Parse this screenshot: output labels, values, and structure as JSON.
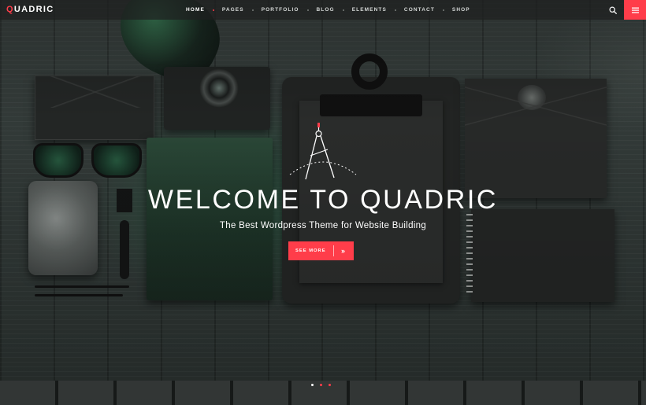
{
  "brand": {
    "first_letter": "Q",
    "rest": "UADRIC",
    "accent": "#ff3d4a"
  },
  "nav": {
    "items": [
      {
        "label": "HOME",
        "active": true
      },
      {
        "label": "PAGES"
      },
      {
        "label": "PORTFOLIO"
      },
      {
        "label": "BLOG"
      },
      {
        "label": "ELEMENTS"
      },
      {
        "label": "CONTACT"
      },
      {
        "label": "SHOP"
      }
    ],
    "search_icon": "search-icon",
    "menu_icon": "hamburger-icon"
  },
  "hero": {
    "title": "WELCOME TO QUADRIC",
    "subtitle": "The Best Wordpress Theme for Website Building",
    "cta_label": "SEE MORE",
    "cta_icon": "double-chevron-right-icon",
    "graphic_icon": "compass-icon"
  },
  "slider": {
    "count": 3,
    "active_index": 0
  }
}
